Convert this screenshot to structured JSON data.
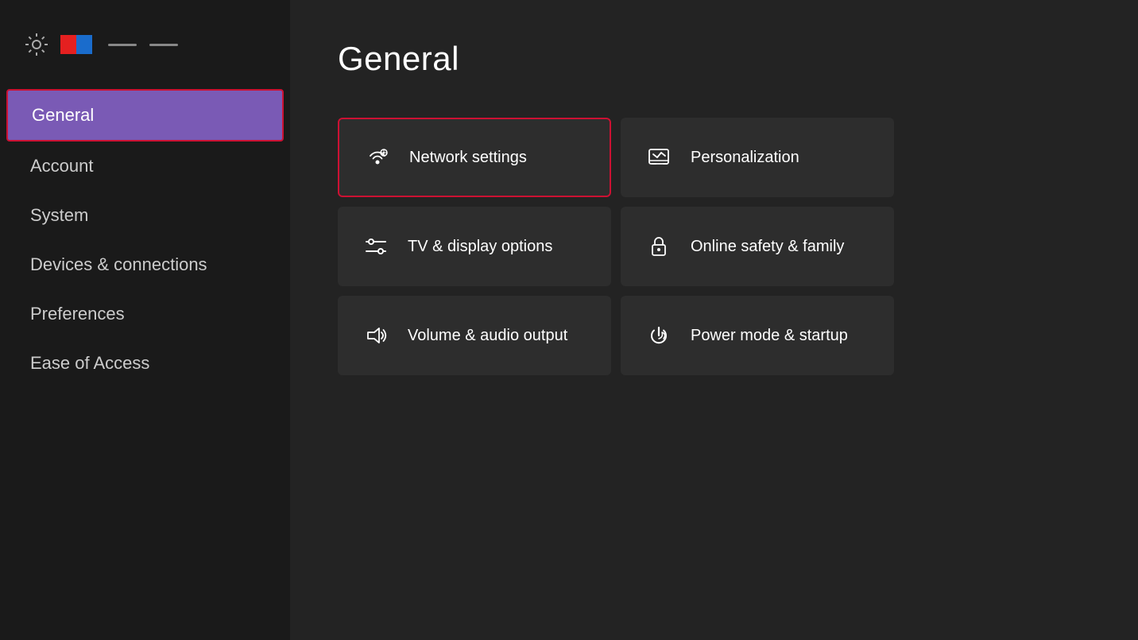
{
  "header": {
    "title": "General"
  },
  "sidebar": {
    "items": [
      {
        "id": "general",
        "label": "General",
        "active": true
      },
      {
        "id": "account",
        "label": "Account",
        "active": false
      },
      {
        "id": "system",
        "label": "System",
        "active": false
      },
      {
        "id": "devices-connections",
        "label": "Devices & connections",
        "active": false
      },
      {
        "id": "preferences",
        "label": "Preferences",
        "active": false
      },
      {
        "id": "ease-of-access",
        "label": "Ease of Access",
        "active": false
      }
    ]
  },
  "tiles": [
    {
      "id": "network-settings",
      "label": "Network settings",
      "icon": "network",
      "highlighted": true
    },
    {
      "id": "personalization",
      "label": "Personalization",
      "icon": "personalization",
      "highlighted": false
    },
    {
      "id": "tv-display",
      "label": "TV & display options",
      "icon": "display",
      "highlighted": false
    },
    {
      "id": "online-safety",
      "label": "Online safety & family",
      "icon": "lock",
      "highlighted": false
    },
    {
      "id": "volume-audio",
      "label": "Volume & audio output",
      "icon": "audio",
      "highlighted": false
    },
    {
      "id": "power-mode",
      "label": "Power mode & startup",
      "icon": "power",
      "highlighted": false
    }
  ]
}
